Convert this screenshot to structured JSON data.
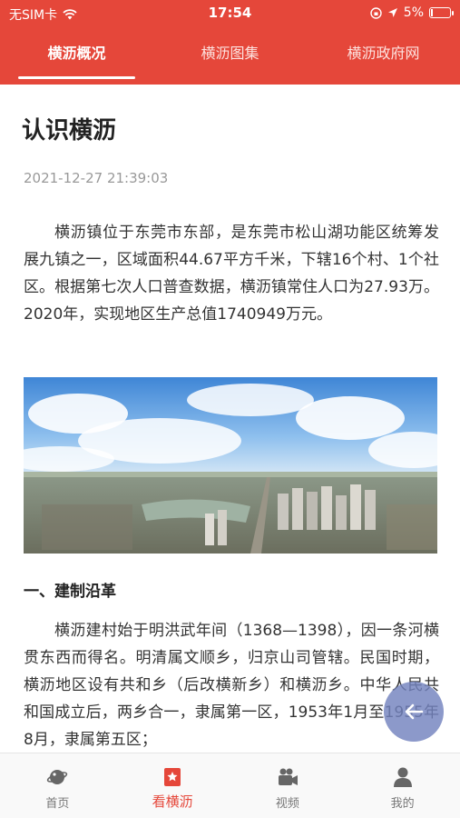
{
  "status_bar": {
    "carrier": "无SIM卡",
    "time": "17:54",
    "battery": "5%",
    "battery_level_percent": 5,
    "icons": [
      "wifi-icon",
      "screen-lock-icon",
      "location-icon",
      "battery-icon"
    ]
  },
  "tabs": [
    {
      "label": "横沥概况",
      "active": true
    },
    {
      "label": "横沥图集",
      "active": false
    },
    {
      "label": "横沥政府网",
      "active": false
    }
  ],
  "article": {
    "title": "认识横沥",
    "timestamp": "2021-12-27 21:39:03",
    "intro": "横沥镇位于东莞市东部，是东莞市松山湖功能区统筹发展九镇之一，区域面积44.67平方千米，下辖16个村、1个社区。根据第七次人口普查数据，横沥镇常住人口为27.93万。2020年，实现地区生产总值1740949万元。",
    "section1_title": "一、建制沿革",
    "section1_text": "横沥建村始于明洪武年间（1368—1398），因一条河横贯东西而得名。明清属文顺乡，归京山司管辖。民国时期，横沥地区设有共和乡（后改横新乡）和横沥乡。中华人民共和国成立后，两乡合一，隶属第一区，1953年1月至1955年8月，隶属第五区；"
  },
  "fab": {
    "icon": "back-arrow-icon"
  },
  "bottom_nav": [
    {
      "label": "首页",
      "icon": "planet-icon",
      "active": false
    },
    {
      "label": "看横沥",
      "icon": "bookmark-star-icon",
      "active": true
    },
    {
      "label": "视频",
      "icon": "video-camera-icon",
      "active": false
    },
    {
      "label": "我的",
      "icon": "person-icon",
      "active": false
    }
  ],
  "colors": {
    "brand": "#e5473a",
    "nav_inactive": "#777777",
    "timestamp": "#999999"
  }
}
